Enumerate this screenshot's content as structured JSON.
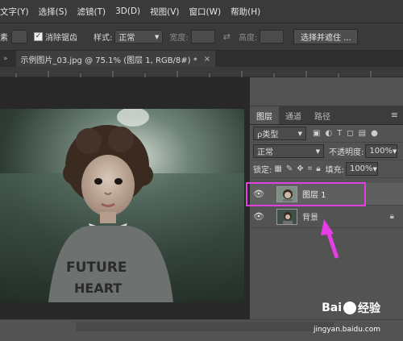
{
  "menu": [
    "文字(Y)",
    "选择(S)",
    "滤镜(T)",
    "3D(D)",
    "视图(V)",
    "窗口(W)",
    "帮助(H)"
  ],
  "options": {
    "left_label": "素",
    "anti_alias_label": "消除锯齿",
    "style_label": "样式:",
    "style_value": "正常",
    "width_label": "宽度:",
    "height_label": "高度:",
    "select_mask_button": "选择并遮住 ..."
  },
  "document_tab": {
    "title": "示例图片_03.jpg @ 75.1% (图层 1, RGB/8#) *",
    "close_icon": "×"
  },
  "photo": {
    "shirt_text_line1": "FUTURE",
    "shirt_text_line2": "HEART"
  },
  "layers_panel": {
    "tabs": [
      "图层",
      "通道",
      "路径"
    ],
    "kind_label": "ρ类型",
    "blend_mode": "正常",
    "opacity_label": "不透明度:",
    "opacity_value": "100%",
    "lock_label": "锁定:",
    "fill_label": "填充:",
    "fill_value": "100%",
    "layers": [
      {
        "name": "图层 1",
        "selected": true
      },
      {
        "name": "背景",
        "locked": true
      }
    ]
  },
  "watermark": {
    "brand": "Bai",
    "brand2": "经验",
    "url": "jingyan.baidu.com"
  },
  "colors": {
    "highlight_box": "#e040e0",
    "arrow": "#e63ee6",
    "selected_row": "#5f5f5f"
  }
}
